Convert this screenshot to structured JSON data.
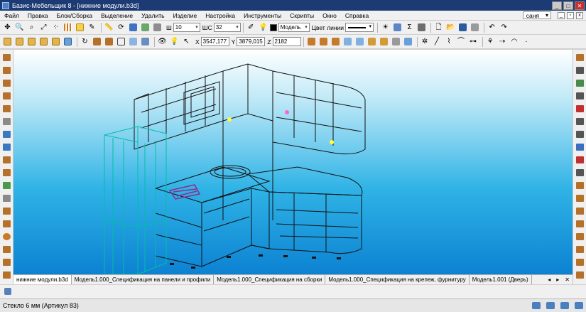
{
  "window": {
    "title": "Базис-Мебельщик 8 - [нижние модули.b3d]"
  },
  "menu": {
    "items": [
      "Файл",
      "Правка",
      "Блок/Сборка",
      "Выделение",
      "Удалить",
      "Изделие",
      "Настройка",
      "Инструменты",
      "Скрипты",
      "Окно",
      "Справка"
    ],
    "user": "саня"
  },
  "toolbar1": {
    "sh_label": "Ш",
    "sh_value": "10",
    "shs_label": "ШС",
    "shs_value": "32",
    "model_value": "Модель",
    "line_color_label": "Цвет линии"
  },
  "toolbar2": {
    "x_label": "X",
    "x_value": "3547,177",
    "y_label": "Y",
    "y_value": "3879,015",
    "z_label": "Z",
    "z_value": "2182"
  },
  "tabs": [
    "нижние модули.b3d",
    "Модель1.000_Спецификация на панели и профили",
    "Модель1.000_Спецификация на сборки",
    "Модель1.000_Спецификация на крепеж, фурнитуру",
    "Модель1.001 (Дверь)"
  ],
  "tab_nav": {
    "prev": "◂",
    "next": "▸",
    "close": "✕"
  },
  "status": {
    "text": "Стекло 6 мм  (Артикул 83)"
  },
  "colors": {
    "titlebar": "#1c3a73",
    "viewport_top": "#ffffff",
    "viewport_bottom": "#0c82d2",
    "fridge": "#00bfa5",
    "selection": "#8e2d8e",
    "marker": "#ffff33"
  },
  "icons": {
    "toolbar1": [
      "new-icon",
      "open-icon",
      "zoom-in-icon",
      "zoom-out-icon",
      "fit-icon",
      "grid-icon",
      "select-icon",
      "pencil-icon",
      "measure-icon",
      "rotate-icon",
      "view-icon",
      "snap-icon",
      "align-icon",
      "color-picker-icon"
    ],
    "toolbar1_right": [
      "lamp-icon",
      "sigma-icon",
      "format-icon",
      "document-icon",
      "folder-icon",
      "save-icon",
      "print-icon",
      "undo-icon",
      "redo-icon"
    ],
    "toolbar2": [
      "view-front-icon",
      "view-top-icon",
      "view-left-icon",
      "view-iso-icon",
      "box-icon",
      "panel-icon",
      "wire-icon",
      "render-icon",
      "light-icon",
      "camera-icon",
      "shadow-icon",
      "texture-icon",
      "cube-icon",
      "layer-icon",
      "pointer-icon",
      "cursor-icon"
    ],
    "toolbar2_right": [
      "panel-h-icon",
      "panel-v-icon",
      "panel-front-icon",
      "plane-icon",
      "link-icon",
      "dimension-icon",
      "arrow-icon",
      "hatch-icon",
      "line-icon",
      "polyline-icon",
      "arc-icon",
      "wizard-icon",
      "section-icon",
      "point-icon"
    ],
    "left": [
      "panel-icon",
      "shelf-icon",
      "door-icon",
      "drawer-icon",
      "facade-icon",
      "profile-icon",
      "hinge-icon",
      "handle-icon",
      "leg-icon",
      "plinth-icon",
      "glass-icon",
      "sink-icon",
      "plate-icon",
      "hood-icon",
      "mirror-icon",
      "lamp-icon",
      "cone-icon",
      "sphere-icon",
      "cylinder-icon",
      "cube-icon"
    ],
    "right": [
      "wall-icon",
      "frame-icon",
      "array-icon",
      "copy-icon",
      "move-icon",
      "rotate-icon",
      "mirror-icon",
      "scale-icon",
      "split-icon",
      "join-icon",
      "cut-icon",
      "drill-icon",
      "edge-icon",
      "groove-icon",
      "chamfer-icon",
      "round-icon",
      "hole-icon",
      "trim-icon",
      "extend-icon",
      "offset-icon"
    ]
  }
}
